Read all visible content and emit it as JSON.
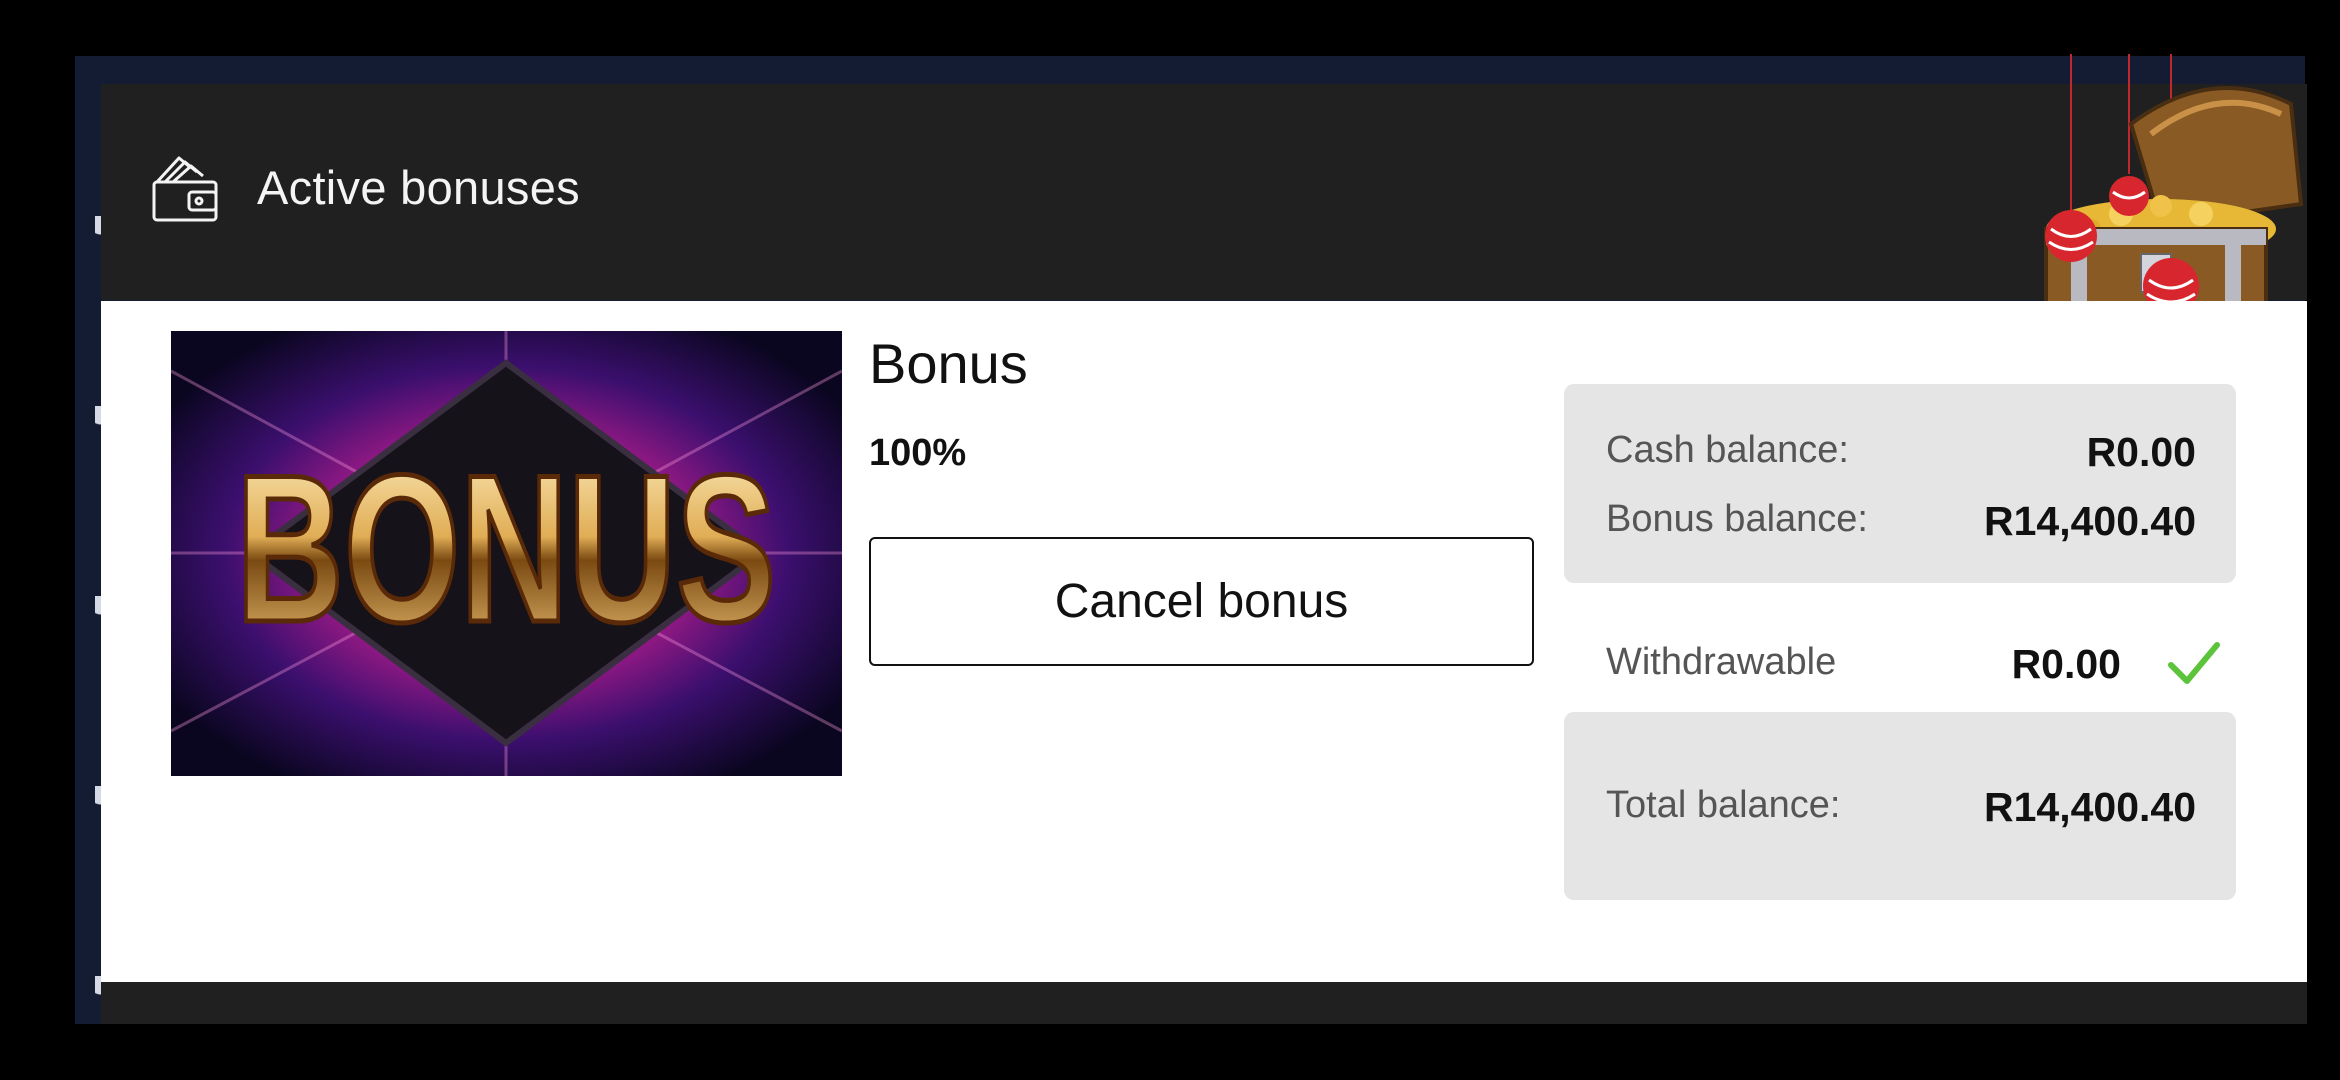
{
  "header": {
    "title": "Active bonuses",
    "icon": "wallet-icon",
    "decoration": "treasure-chest"
  },
  "bonus": {
    "image_text": "BONUS",
    "title": "Bonus",
    "percent": "100%",
    "cancel_label": "Cancel bonus"
  },
  "balances": {
    "cash_label": "Cash balance:",
    "cash_value": "R0.00",
    "bonus_label": "Bonus balance:",
    "bonus_value": "R14,400.40",
    "withdrawable_label": "Withdrawable",
    "withdrawable_value": "R0.00",
    "withdrawable_status_icon": "check-icon",
    "total_label": "Total balance:",
    "total_value": "R14,400.40"
  },
  "colors": {
    "header_bg": "#202020",
    "body_bg": "#ffffff",
    "balance_box_bg": "#e5e5e5",
    "check_green": "#5cc43a"
  }
}
